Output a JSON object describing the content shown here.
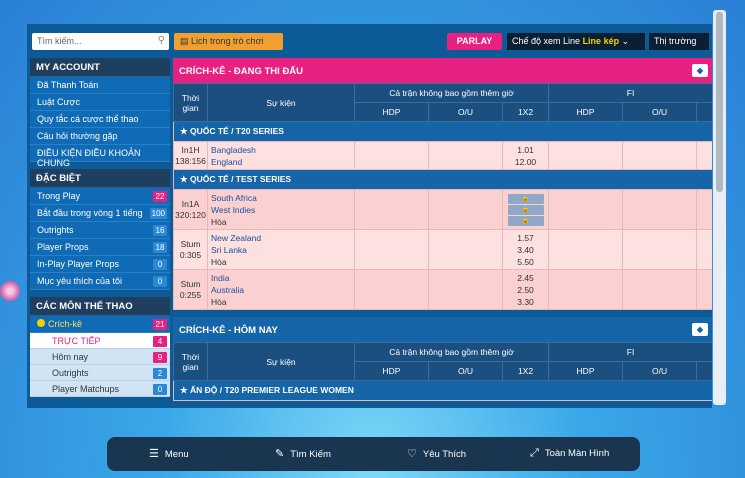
{
  "topbar": {
    "search_placeholder": "Tìm kiếm...",
    "schedule_label": "Lịch trong trò chơi",
    "parlay_label": "PARLAY",
    "mode_label": "Chế độ xem Line",
    "mode_value": "Line kép",
    "market_label": "Thị trường"
  },
  "sidebar": {
    "my_account": "MY ACCOUNT",
    "account_items": [
      "Đã Thanh Toán",
      "Luật Cược",
      "Quy tắc cá cược thể thao",
      "Câu hỏi thường gặp",
      "ĐIỀU KIỆN ĐIỀU KHOẢN CHUNG"
    ],
    "special": "ĐẶC BIỆT",
    "special_items": [
      {
        "label": "Trong Play",
        "count": "22"
      },
      {
        "label": "Bắt đầu trong vòng 1 tiếng",
        "count": "100"
      },
      {
        "label": "Outrights",
        "count": "16"
      },
      {
        "label": "Player Props",
        "count": "18"
      },
      {
        "label": "In-Play Player Props",
        "count": "0"
      },
      {
        "label": "Mục yêu thích của tôi",
        "count": "0"
      }
    ],
    "sports": "CÁC MÔN THỂ THAO",
    "sport_selected": {
      "label": "Crích-kê",
      "count": "21"
    },
    "sub_items": [
      {
        "label": "TRỰC TIẾP",
        "count": "4"
      },
      {
        "label": "Hôm nay",
        "count": "9"
      },
      {
        "label": "Outrights",
        "count": "2"
      },
      {
        "label": "Player Matchups",
        "count": "0"
      }
    ]
  },
  "live_section": {
    "title": "CRÍCH-KÊ - ĐANG THI ĐẤU",
    "col_time": "Thời gian",
    "col_event": "Sự kiện",
    "col_fulltime": "Cả trận không bao gồm thêm giờ",
    "col_fi": "FI",
    "col_hdp": "HDP",
    "col_ou": "O/U",
    "col_1x2": "1X2",
    "leagues": [
      {
        "name": "QUỐC TẾ / T20 SERIES",
        "matches": [
          {
            "time1": "In1H",
            "time2": "138:156",
            "home": "Bangladesh",
            "away": "England",
            "draw": "",
            "odds": [
              "1.01",
              "12.00",
              ""
            ],
            "locked": false
          }
        ]
      },
      {
        "name": "QUỐC TẾ / TEST SERIES",
        "matches": [
          {
            "time1": "In1A",
            "time2": "320:120",
            "home": "South Africa",
            "away": "West Indies",
            "draw": "Hòa",
            "odds": [
              "",
              "",
              ""
            ],
            "locked": true
          },
          {
            "time1": "Stum",
            "time2": "0:305",
            "home": "New Zealand",
            "away": "Sri Lanka",
            "draw": "Hòa",
            "odds": [
              "1.57",
              "3.40",
              "5.50"
            ],
            "locked": false
          },
          {
            "time1": "Stum",
            "time2": "0:255",
            "home": "India",
            "away": "Australia",
            "draw": "Hòa",
            "odds": [
              "2.45",
              "2.50",
              "3.30"
            ],
            "locked": false
          }
        ]
      }
    ]
  },
  "today_section": {
    "title": "CRÍCH-KÊ - HÔM NAY",
    "league": "ẤN ĐỘ / T20 PREMIER LEAGUE WOMEN"
  },
  "bottombar": {
    "menu": "Menu",
    "search": "Tìm Kiếm",
    "favorites": "Yêu Thích",
    "fullscreen": "Toàn Màn Hình"
  }
}
